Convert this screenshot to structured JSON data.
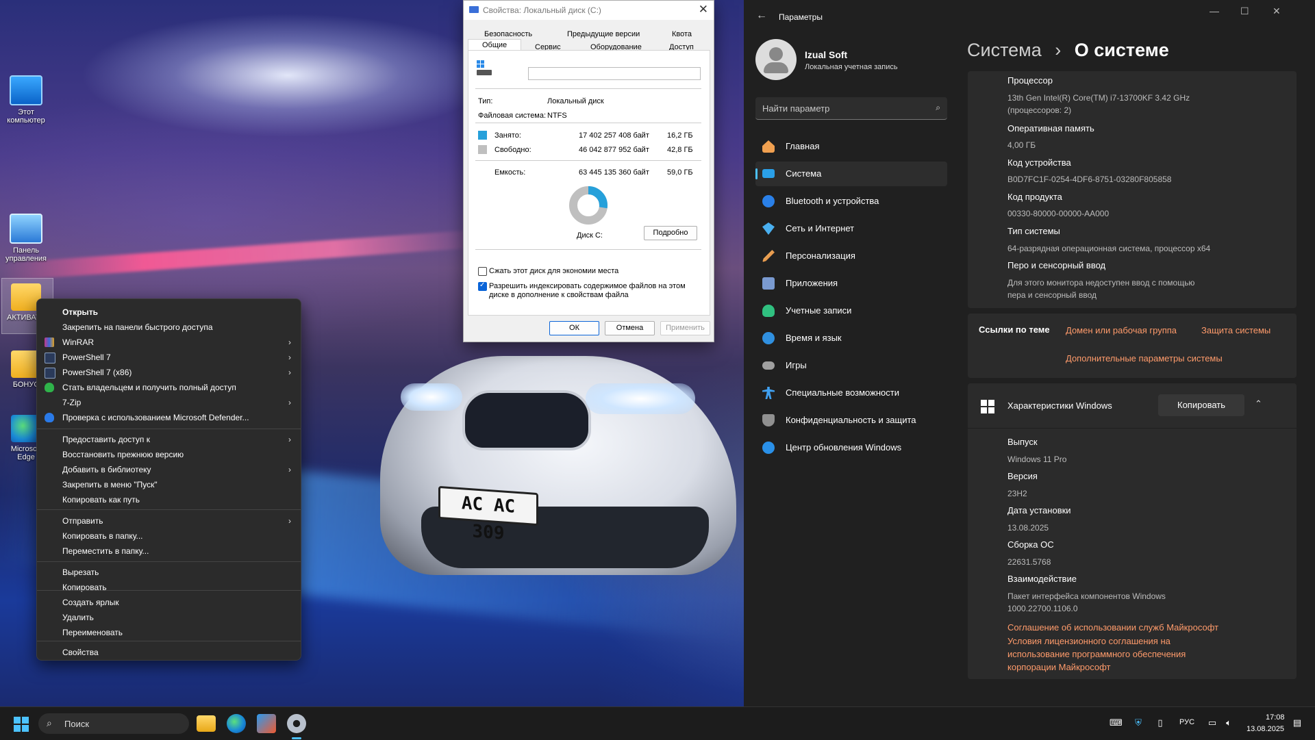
{
  "desktop": {
    "icons": [
      {
        "label": "Этот компьютер"
      },
      {
        "label": "Панель управления"
      },
      {
        "label": "АКТИВАТОРЫ"
      },
      {
        "label": "БОНУС"
      },
      {
        "label": "Microsoft Edge"
      }
    ],
    "plate_text": "AC AC 309"
  },
  "context_menu": {
    "items": [
      {
        "label": "Открыть"
      },
      {
        "label": "Закрепить на панели быстрого доступа"
      },
      {
        "label": "WinRAR"
      },
      {
        "label": "PowerShell 7"
      },
      {
        "label": "PowerShell 7 (x86)"
      },
      {
        "label": "Стать владельцем и получить полный доступ"
      },
      {
        "label": "7-Zip"
      },
      {
        "label": "Проверка с использованием Microsoft Defender..."
      },
      {
        "label": "Предоставить доступ к"
      },
      {
        "label": "Восстановить прежнюю версию"
      },
      {
        "label": "Добавить в библиотеку"
      },
      {
        "label": "Закрепить в меню \"Пуск\""
      },
      {
        "label": "Копировать как путь"
      },
      {
        "label": "Отправить"
      },
      {
        "label": "Копировать в папку..."
      },
      {
        "label": "Переместить в папку..."
      },
      {
        "label": "Вырезать"
      },
      {
        "label": "Копировать"
      },
      {
        "label": "Создать ярлык"
      },
      {
        "label": "Удалить"
      },
      {
        "label": "Переименовать"
      },
      {
        "label": "Свойства"
      }
    ]
  },
  "properties": {
    "title": "Свойства: Локальный диск (C:)",
    "tabs_top": [
      "Безопасность",
      "Предыдущие версии",
      "Квота"
    ],
    "tabs_bottom": [
      "Общие",
      "Сервис",
      "Оборудование",
      "Доступ"
    ],
    "name_value": "",
    "type_label": "Тип:",
    "type_value": "Локальный диск",
    "fs_label": "Файловая система:",
    "fs_value": "NTFS",
    "used_label": "Занято:",
    "used_bytes": "17 402 257 408 байт",
    "used_gb": "16,2 ГБ",
    "free_label": "Свободно:",
    "free_bytes": "46 042 877 952 байт",
    "free_gb": "42,8 ГБ",
    "cap_label": "Емкость:",
    "cap_bytes": "63 445 135 360 байт",
    "cap_gb": "59,0 ГБ",
    "used_fraction": 0.274,
    "disk_label": "Диск C:",
    "details_button": "Подробно",
    "compress_label": "Сжать этот диск для экономии места",
    "index_label_1": "Разрешить индексировать содержимое файлов на этом",
    "index_label_2": "диске в дополнение к свойствам файла",
    "ok": "ОК",
    "cancel": "Отмена",
    "apply": "Применить",
    "used_color": "#26a0da",
    "free_color": "#bfbfbf"
  },
  "settings": {
    "title": "Параметры",
    "user_name": "Izual Soft",
    "user_type": "Локальная учетная запись",
    "search_placeholder": "Найти параметр",
    "nav": [
      {
        "label": "Главная",
        "icon": "home-icon",
        "color": "#f0a050"
      },
      {
        "label": "Система",
        "icon": "system-icon",
        "color": "#2aa0e8"
      },
      {
        "label": "Bluetooth и устройства",
        "icon": "bluetooth-icon",
        "color": "#2a80e8"
      },
      {
        "label": "Сеть и Интернет",
        "icon": "network-icon",
        "color": "#4ab0f0"
      },
      {
        "label": "Персонализация",
        "icon": "brush-icon",
        "color": "#e8a040"
      },
      {
        "label": "Приложения",
        "icon": "apps-icon",
        "color": "#7a9ad0"
      },
      {
        "label": "Учетные записи",
        "icon": "accounts-icon",
        "color": "#30c080"
      },
      {
        "label": "Время и язык",
        "icon": "time-language-icon",
        "color": "#3090e0"
      },
      {
        "label": "Игры",
        "icon": "gamepad-icon",
        "color": "#a0a0a0"
      },
      {
        "label": "Специальные возможности",
        "icon": "accessibility-icon",
        "color": "#40a0f0"
      },
      {
        "label": "Конфиденциальность и защита",
        "icon": "shield-icon",
        "color": "#909090"
      },
      {
        "label": "Центр обновления Windows",
        "icon": "update-icon",
        "color": "#2a90e8"
      }
    ],
    "breadcrumb_parent": "Система",
    "breadcrumb_sep": "›",
    "breadcrumb_current": "О системе",
    "device_specs": [
      {
        "key": "Процессор",
        "value": "13th Gen Intel(R) Core(TM) i7-13700KF   3.42 GHz",
        "value2": "(процессоров: 2)"
      },
      {
        "key": "Оперативная память",
        "value": "4,00 ГБ"
      },
      {
        "key": "Код устройства",
        "value": "B0D7FC1F-0254-4DF6-8751-03280F805858"
      },
      {
        "key": "Код продукта",
        "value": "00330-80000-00000-AA000"
      },
      {
        "key": "Тип системы",
        "value": "64-разрядная операционная система, процессор x64"
      },
      {
        "key": "Перо и сенсорный ввод",
        "value": "Для этого монитора недоступен ввод с помощью",
        "value2": "пера и сенсорный ввод"
      }
    ],
    "related_title": "Ссылки по теме",
    "related_links": [
      "Домен или рабочая группа",
      "Защита системы",
      "Дополнительные параметры системы"
    ],
    "win_spec_title": "Характеристики Windows",
    "copy_button": "Копировать",
    "windows_specs": [
      {
        "key": "Выпуск",
        "value": "Windows 11 Pro"
      },
      {
        "key": "Версия",
        "value": "23H2"
      },
      {
        "key": "Дата установки",
        "value": "13.08.2025"
      },
      {
        "key": "Сборка ОС",
        "value": "22631.5768"
      },
      {
        "key": "Взаимодействие",
        "value": "Пакет интерфейса компонентов Windows",
        "value2": "1000.22700.1106.0"
      }
    ],
    "agreement_1": "Соглашение об использовании служб Майкрософт",
    "agreement_2a": "Условия лицензионного соглашения на",
    "agreement_2b": "использование программного обеспечения",
    "agreement_2c": "корпорации Майкрософт",
    "accent_color": "#4cc2ff",
    "link_color": "#ff9b6b"
  },
  "taskbar": {
    "search_placeholder": "Поиск",
    "lang": "РУС",
    "time": "17:08",
    "date": "13.08.2025"
  }
}
